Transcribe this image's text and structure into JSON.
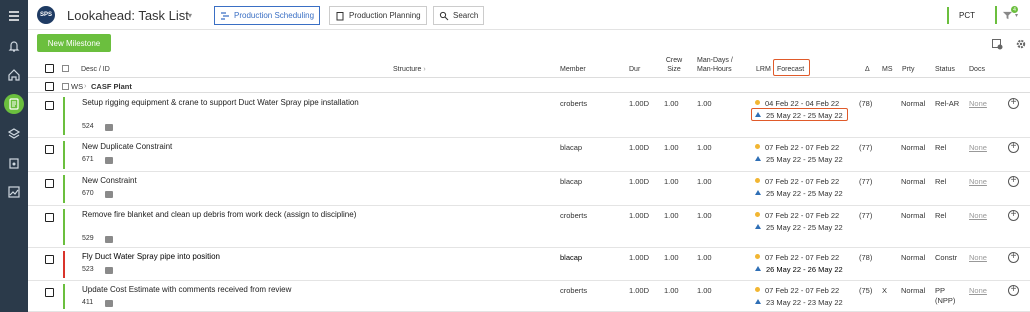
{
  "app": {
    "logo_text": "SPS",
    "title": "Lookahead: Task List"
  },
  "tabs": [
    {
      "label": "Production Scheduling",
      "active": true
    },
    {
      "label": "Production Planning",
      "active": false
    },
    {
      "label": "Search",
      "active": false
    }
  ],
  "topright": {
    "pct_label": "PCT",
    "filter_badge": "4"
  },
  "toolbar": {
    "new_milestone": "New Milestone"
  },
  "columns": {
    "desc": "Desc / ID",
    "structure": "Structure",
    "member": "Member",
    "dur": "Dur",
    "crew_size_1": "Crew",
    "crew_size_2": "Size",
    "mandays_1": "Man-Days /",
    "mandays_2": "Man-Hours",
    "lrm": "LRM",
    "forecast": "Forecast",
    "delta": "Δ",
    "ms": "MS",
    "prty": "Prty",
    "status": "Status",
    "docs": "Docs"
  },
  "group": {
    "ws_label": "WS",
    "name": "CASF Plant"
  },
  "rows": [
    {
      "desc": "Setup rigging equipment & crane to support Duct Water Spray pipe installation",
      "id": "524",
      "member": "croberts",
      "dur": "1.00D",
      "crew": "1.00",
      "mandays": "1.00",
      "lrm": "04 Feb 22 - 04 Feb 22",
      "forecast": "25 May 22 - 25 May 22",
      "delta": "(78)",
      "ms": "",
      "prty": "Normal",
      "status": "Rel-AR",
      "status2": "",
      "docs": "None",
      "bar_color": "#6bbf3e",
      "bold": false
    },
    {
      "desc": "New Duplicate Constraint",
      "id": "671",
      "member": "blacap",
      "dur": "1.00D",
      "crew": "1.00",
      "mandays": "1.00",
      "lrm": "07 Feb 22 - 07 Feb 22",
      "forecast": "25 May 22 - 25 May 22",
      "delta": "(77)",
      "ms": "",
      "prty": "Normal",
      "status": "Rel",
      "status2": "",
      "docs": "None",
      "bar_color": "#6bbf3e",
      "bold": false
    },
    {
      "desc": "New Constraint",
      "id": "670",
      "member": "blacap",
      "dur": "1.00D",
      "crew": "1.00",
      "mandays": "1.00",
      "lrm": "07 Feb 22 - 07 Feb 22",
      "forecast": "25 May 22 - 25 May 22",
      "delta": "(77)",
      "ms": "",
      "prty": "Normal",
      "status": "Rel",
      "status2": "",
      "docs": "None",
      "bar_color": "#6bbf3e",
      "bold": false
    },
    {
      "desc": "Remove fire blanket and clean up debris from work deck (assign to discipline)",
      "id": "529",
      "member": "croberts",
      "dur": "1.00D",
      "crew": "1.00",
      "mandays": "1.00",
      "lrm": "07 Feb 22 - 07 Feb 22",
      "forecast": "25 May 22 - 25 May 22",
      "delta": "(77)",
      "ms": "",
      "prty": "Normal",
      "status": "Rel",
      "status2": "",
      "docs": "None",
      "bar_color": "#6bbf3e",
      "bold": false
    },
    {
      "desc": "Fly Duct Water Spray pipe into position",
      "id": "523",
      "member": "blacap",
      "dur": "1.00D",
      "crew": "1.00",
      "mandays": "1.00",
      "lrm": "07 Feb 22 - 07 Feb 22",
      "forecast": "26 May 22 - 26 May 22",
      "delta": "(78)",
      "ms": "",
      "prty": "Normal",
      "status": "Constr",
      "status2": "",
      "docs": "None",
      "bar_color": "#d9342b",
      "bold": true
    },
    {
      "desc": "Update Cost Estimate with comments received from review",
      "id": "411",
      "member": "croberts",
      "dur": "1.00D",
      "crew": "1.00",
      "mandays": "1.00",
      "lrm": "07 Feb 22 - 07 Feb 22",
      "forecast": "23 May 22 - 23 May 22",
      "delta": "(75)",
      "ms": "X",
      "prty": "Normal",
      "status": "PP",
      "status2": "(NPP)",
      "docs": "None",
      "bar_color": "#6bbf3e",
      "bold": false
    }
  ]
}
